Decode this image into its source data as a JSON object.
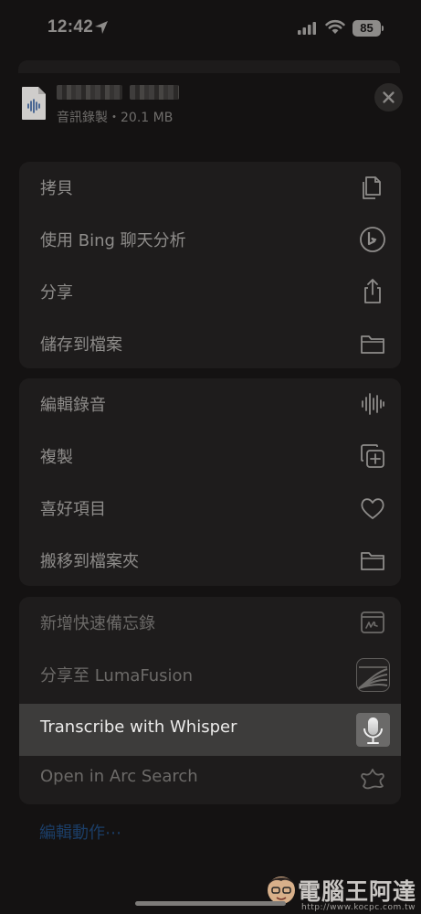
{
  "status_bar": {
    "time": "12:42",
    "battery": "85"
  },
  "file": {
    "subtitle": "音訊錄製・20.1 MB"
  },
  "groups": [
    {
      "items": [
        {
          "label": "拷貝",
          "icon": "copy-icon"
        },
        {
          "label": "使用 Bing 聊天分析",
          "icon": "bing-icon"
        },
        {
          "label": "分享",
          "icon": "share-icon"
        },
        {
          "label": "儲存到檔案",
          "icon": "folder-icon"
        }
      ]
    },
    {
      "items": [
        {
          "label": "編輯錄音",
          "icon": "waveform-icon"
        },
        {
          "label": "複製",
          "icon": "duplicate-icon"
        },
        {
          "label": "喜好項目",
          "icon": "heart-icon"
        },
        {
          "label": "搬移到檔案夾",
          "icon": "folder-icon"
        }
      ]
    },
    {
      "items": [
        {
          "label": "新增快速備忘錄",
          "icon": "quick-note-icon"
        },
        {
          "label": "分享至 LumaFusion",
          "icon": "lumafusion-app-icon"
        },
        {
          "label": "Transcribe with Whisper",
          "icon": "whisper-microphone-icon"
        },
        {
          "label": "Open in Arc Search",
          "icon": "arc-search-icon"
        }
      ]
    }
  ],
  "edit_actions": "編輯動作⋯",
  "watermark": {
    "title": "電腦王阿達",
    "url": "http://www.kocpc.com.tw"
  }
}
